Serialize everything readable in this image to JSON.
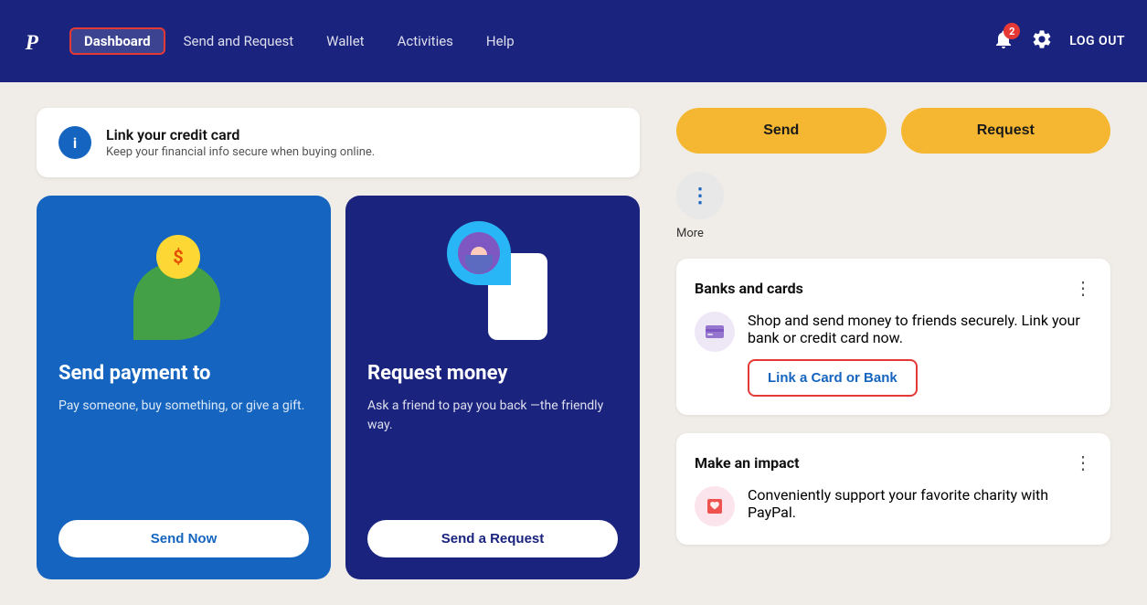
{
  "header": {
    "logo_text": "P",
    "nav": [
      {
        "label": "Dashboard",
        "active": true
      },
      {
        "label": "Send and Request",
        "active": false
      },
      {
        "label": "Wallet",
        "active": false
      },
      {
        "label": "Activities",
        "active": false
      },
      {
        "label": "Help",
        "active": false
      }
    ],
    "notification_count": "2",
    "logout_label": "LOG OUT"
  },
  "info_banner": {
    "title": "Link your credit card",
    "description": "Keep your financial info secure when buying online.",
    "icon": "i"
  },
  "send_card": {
    "title": "Send payment to",
    "description": "Pay someone, buy something, or give a gift.",
    "button_label": "Send Now"
  },
  "request_card": {
    "title": "Request money",
    "description": "Ask a friend to pay you back —the friendly way.",
    "button_label": "Send a Request"
  },
  "actions": {
    "send_label": "Send",
    "request_label": "Request"
  },
  "more": {
    "label": "More",
    "icon": "⋮"
  },
  "banks_section": {
    "title": "Banks and cards",
    "description": "Shop and send money to friends securely. Link your bank or credit card now.",
    "link_label": "Link a Card or Bank"
  },
  "impact_section": {
    "title": "Make an impact",
    "description": "Conveniently support your favorite charity with PayPal."
  }
}
